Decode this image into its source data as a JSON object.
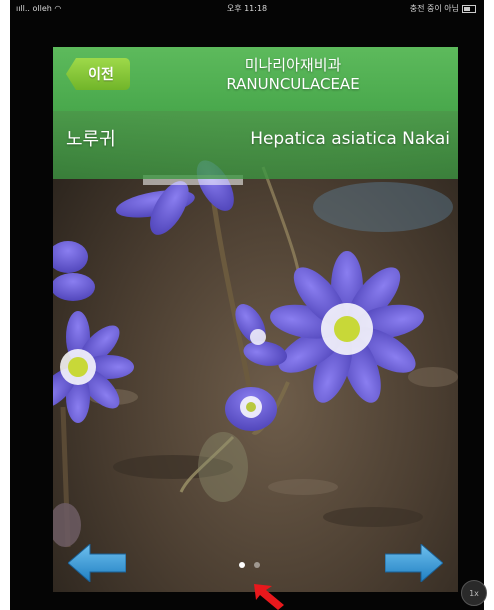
{
  "status_bar": {
    "carrier": "olleh",
    "time": "오후 11:18",
    "right_text": "충전 중이 아님"
  },
  "header": {
    "back_label": "이전",
    "family_korean": "미나리아재비과",
    "family_latin": "RANUNCULACEAE"
  },
  "species": {
    "korean": "노루귀",
    "latin": "Hepatica asiatica Nakai"
  },
  "pager": {
    "total": 2,
    "current": 1
  },
  "zoom_badge": "1x",
  "colors": {
    "header_green": "#5dba5c",
    "back_button_green": "#8fd040",
    "arrow_blue": "#2f8fcf",
    "flower_purple": "#5a4fc0",
    "pointer_red": "#e8181c"
  },
  "icons": {
    "back": "back-arrow-tag",
    "prev": "left-arrow-icon",
    "next": "right-arrow-icon",
    "pointer": "red-pointer-arrow"
  }
}
